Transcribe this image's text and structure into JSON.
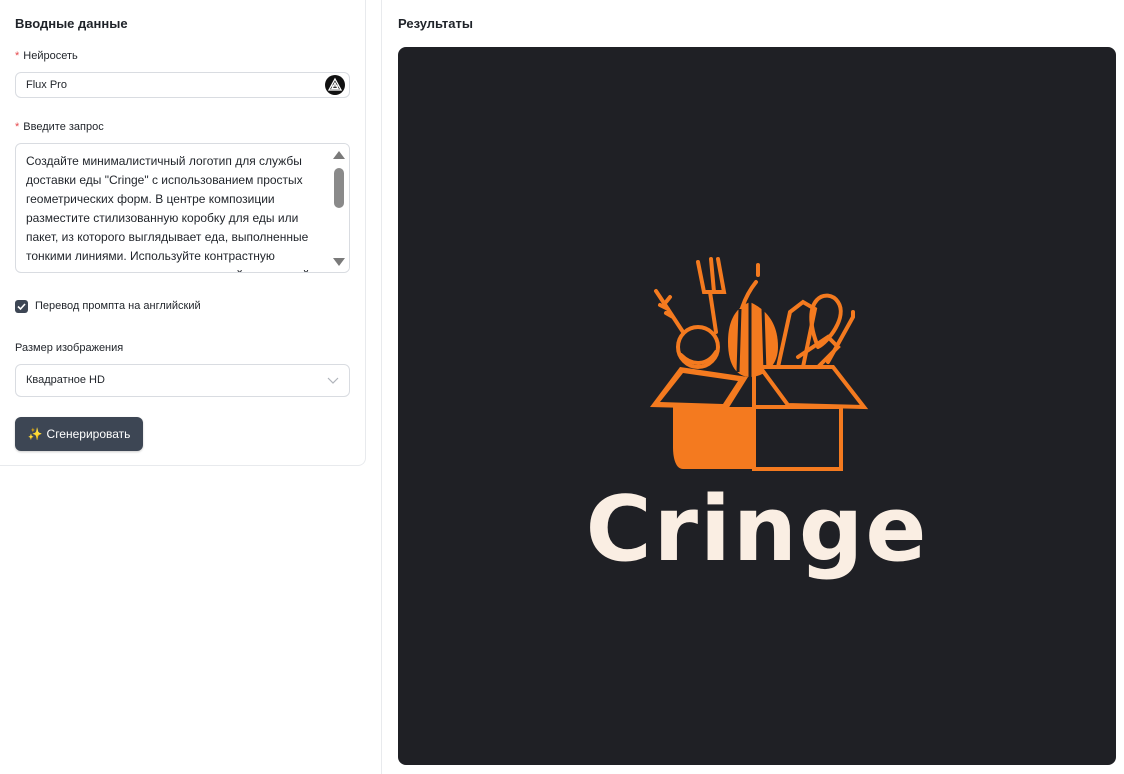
{
  "left": {
    "title": "Вводные данные",
    "model": {
      "label": "Нейросеть",
      "required_mark": "*",
      "value": "Flux Pro",
      "icon": "model-logo-icon"
    },
    "prompt": {
      "label": "Введите запрос",
      "required_mark": "*",
      "value": "Создайте минималистичный логотип для службы доставки еды \"Cringe\" с использованием простых геометрических форм. В центре композиции разместите стилизованную коробку для еды или пакет, из которого выглядывает еда, выполненные тонкими линиями. Используйте контрастную цветовую гамму из двух цветов - яркий оранжевый"
    },
    "translate": {
      "label": "Перевод промпта на английский",
      "checked": true
    },
    "size": {
      "label": "Размер изображения",
      "value": "Квадратное HD"
    },
    "generate_button": {
      "icon": "✨",
      "label": "Сгенерировать"
    }
  },
  "right": {
    "title": "Результаты",
    "image": {
      "logo_text": "Cringe",
      "background": "#1f2025",
      "accent": "#f47a1f",
      "text_color": "#faeee3"
    }
  },
  "colors": {
    "button_bg": "#3d4654",
    "required": "#e5484d"
  }
}
